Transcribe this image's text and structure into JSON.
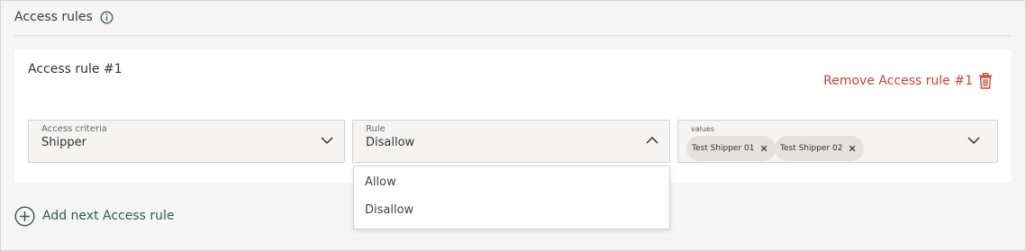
{
  "section": {
    "title": "Access rules"
  },
  "rule": {
    "title": "Access rule #1",
    "remove_label": "Remove Access rule #1",
    "criteria": {
      "label": "Access criteria",
      "value": "Shipper"
    },
    "rule_field": {
      "label": "Rule",
      "value": "Disallow"
    },
    "values_field": {
      "label": "values",
      "chips": [
        "Test Shipper 01",
        "Test Shipper 02"
      ]
    }
  },
  "dropdown": {
    "options": [
      "Allow",
      "Disallow"
    ]
  },
  "add_rule_label": "Add next Access rule",
  "colors": {
    "accent_red": "#c74634",
    "accent_teal": "#2d5c55"
  },
  "icons": {
    "info": "info-icon",
    "trash": "trash-icon",
    "chevron_down": "chevron-down-icon",
    "chevron_up": "chevron-up-icon",
    "close": "close-icon",
    "plus_circle": "plus-circle-icon"
  }
}
